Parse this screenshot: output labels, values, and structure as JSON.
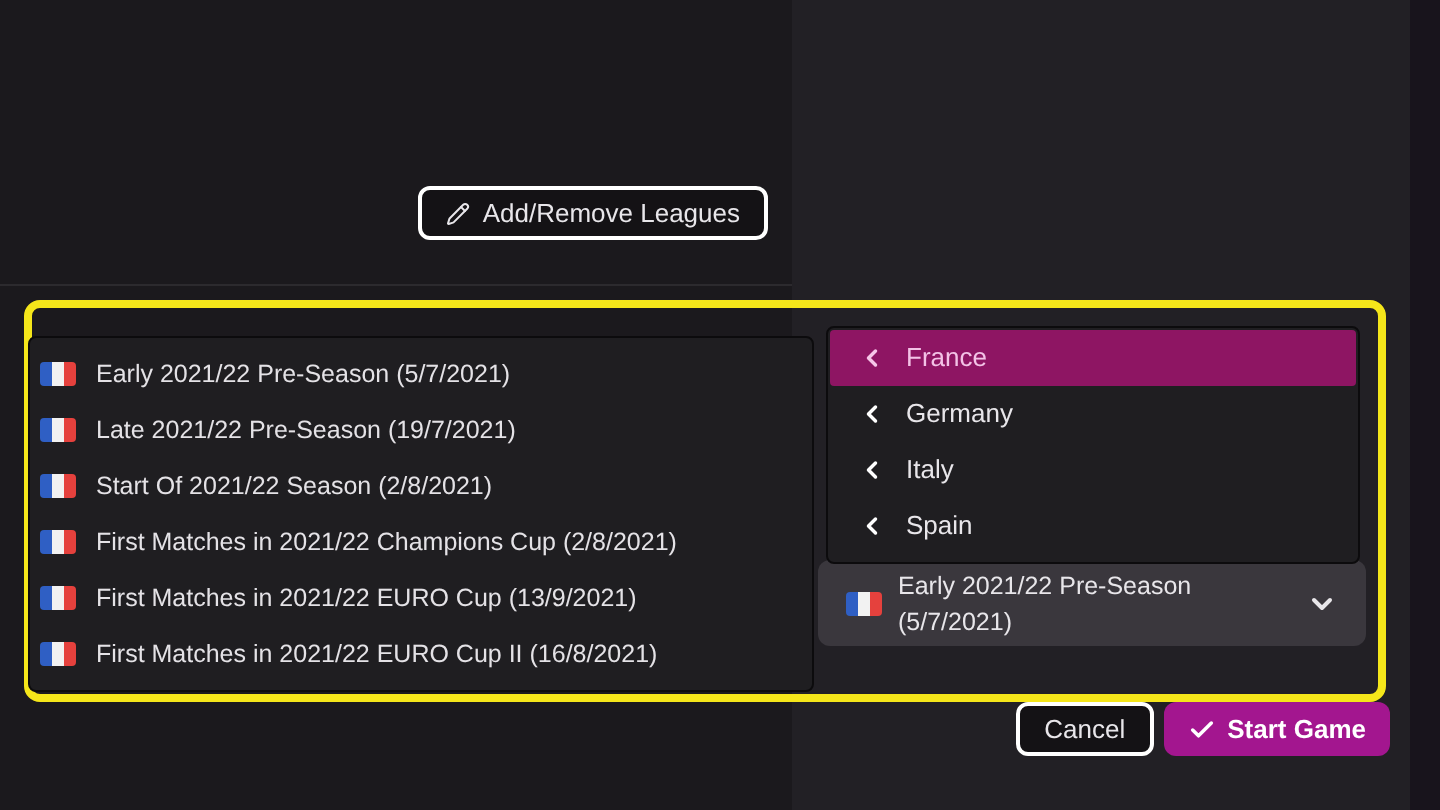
{
  "add_leagues_button": {
    "label": "Add/Remove Leagues"
  },
  "start_date_options": [
    {
      "label": "Early 2021/22 Pre-Season (5/7/2021)"
    },
    {
      "label": "Late 2021/22 Pre-Season (19/7/2021)"
    },
    {
      "label": "Start Of 2021/22 Season (2/8/2021)"
    },
    {
      "label": "First Matches in 2021/22 Champions Cup (2/8/2021)"
    },
    {
      "label": "First Matches in 2021/22 EURO Cup (13/9/2021)"
    },
    {
      "label": "First Matches in 2021/22 EURO Cup II (16/8/2021)"
    }
  ],
  "countries": [
    {
      "label": "France",
      "selected": true
    },
    {
      "label": "Germany",
      "selected": false
    },
    {
      "label": "Italy",
      "selected": false
    },
    {
      "label": "Spain",
      "selected": false
    }
  ],
  "start_date_select": {
    "value": "Early 2021/22 Pre-Season (5/7/2021)"
  },
  "buttons": [
    {
      "kind": "secondary",
      "label": "Cancel"
    },
    {
      "kind": "primary",
      "label": "Start Game"
    }
  ]
}
